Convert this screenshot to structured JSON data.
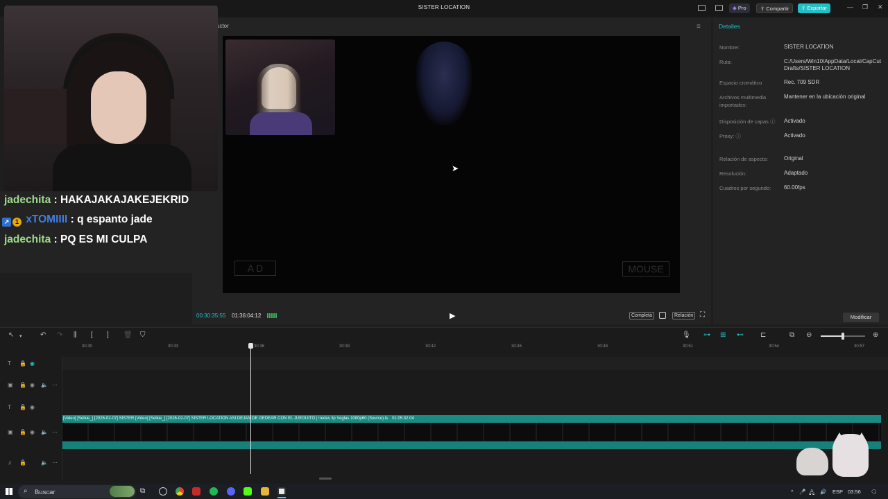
{
  "window": {
    "title": "SISTER LOCATION",
    "pro_label": "Pro",
    "share_label": "Compartir",
    "export_label": "Exportar",
    "minimize_glyph": "—",
    "maximize_glyph": "❐",
    "close_glyph": "✕"
  },
  "player": {
    "title_partial": "uctor",
    "current_time": "00:30:35:55",
    "total_time": "01:36:04:12",
    "full_label": "Completa",
    "ratio_label": "Relación",
    "overlay_keys": "A D",
    "overlay_mouse": "MOUSE"
  },
  "details": {
    "title": "Detalles",
    "fields": [
      {
        "label": "Nombre:",
        "value": "SISTER LOCATION"
      },
      {
        "label": "Ruta:",
        "value": "C:/Users/Win10/AppData/Local/CapCut Drafts/SISTER LOCATION"
      },
      {
        "label": "Espacio cromático",
        "value": "Rec. 709 SDR"
      },
      {
        "label": "Archivos multimedia importados:",
        "value": "Mantener en la ubicación original"
      },
      {
        "label": "Disposición de capas ⓘ",
        "value": "Activado"
      },
      {
        "label": "Proxy: ⓘ",
        "value": "Activado"
      },
      {
        "label": "Relación de aspecto:",
        "value": "Original"
      },
      {
        "label": "Resolución:",
        "value": "Adaptado"
      },
      {
        "label": "Cuadros por segundo:",
        "value": "60.00fps"
      }
    ],
    "modify_label": "Modificar"
  },
  "chat": {
    "messages": [
      {
        "user": "jadechita",
        "sep": " : ",
        "text": "HAKAJAKAJAKEJEKRID"
      },
      {
        "user": "xTOMIIII",
        "sep": " : ",
        "text": "q espanto jade"
      },
      {
        "user": "jadechita",
        "sep": " : ",
        "text": "PQ ES MI CULPA"
      }
    ]
  },
  "timeline": {
    "ticks": [
      "30:30",
      "30:33",
      "30:36",
      "30:39",
      "30:42",
      "30:45",
      "30:48",
      "30:51",
      "30:54",
      "30:57"
    ],
    "clip_label": "[Video] [Selkie_] [2026-02-07] SISTER  [Video] [Selkie_] [2026-02-07] SISTER LOCATION ASI DEJAN DE GEDEAR CON EL JUEGUITO  |  !redes !ip !reglas 1080p60 (Source).ts",
    "clip_duration": "01:05:32:04"
  },
  "taskbar": {
    "search_placeholder": "Buscar",
    "language": "ESP",
    "clock": "03:56"
  },
  "colors": {
    "accent": "#21c0c6",
    "chat_user_green": "#9fdc8c",
    "chat_user_blue": "#3f7fe8",
    "clip_teal": "#1a8a82"
  }
}
